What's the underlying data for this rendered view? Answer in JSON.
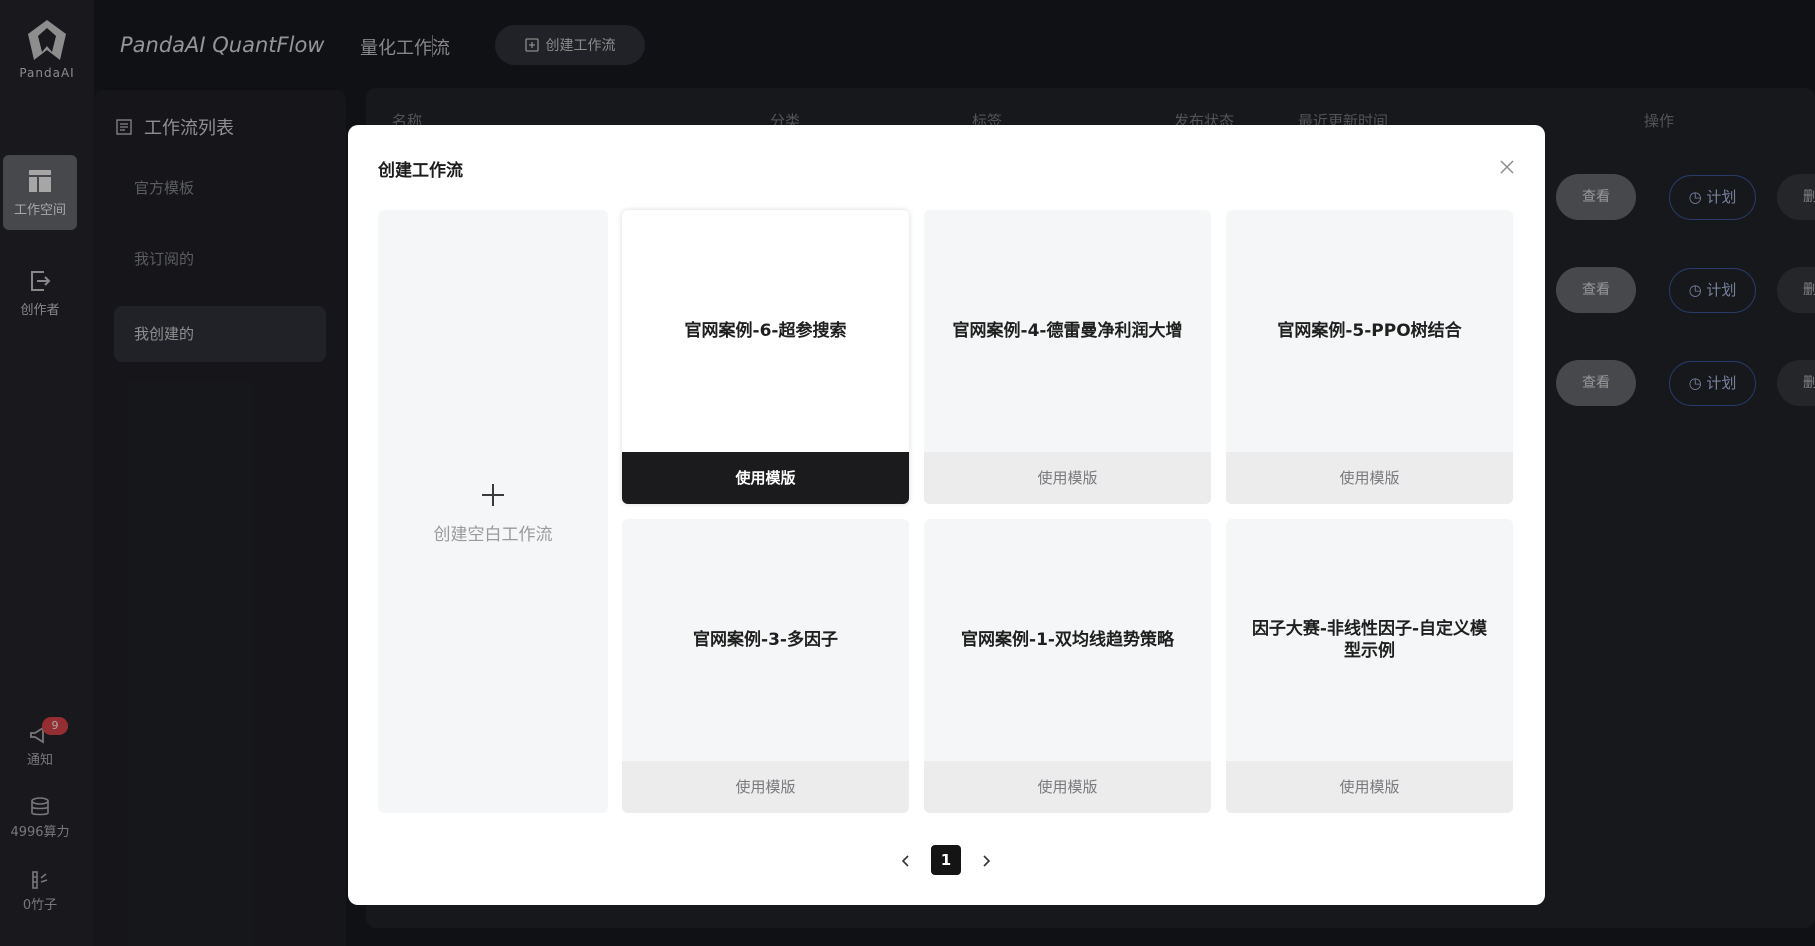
{
  "brand": {
    "name": "PandaAI"
  },
  "rail": {
    "items": [
      {
        "label": "工作空间",
        "icon": "workspace-icon"
      },
      {
        "label": "创作者",
        "icon": "creator-icon"
      }
    ],
    "notify": {
      "label": "通知",
      "badge": "9",
      "icon": "megaphone-icon"
    },
    "compute": {
      "label": "4996算力",
      "icon": "database-icon"
    },
    "bamboo": {
      "label": "0竹子",
      "icon": "bamboo-icon"
    }
  },
  "header": {
    "title": "PandaAI QuantFlow",
    "subtitle": "量化工作流",
    "create_button": "创建工作流"
  },
  "sidepanel": {
    "title": "工作流列表",
    "items": [
      {
        "label": "官方模板"
      },
      {
        "label": "我订阅的"
      },
      {
        "label": "我创建的"
      }
    ]
  },
  "table": {
    "columns": [
      "名称",
      "分类",
      "标签",
      "发布状态",
      "最近更新时间",
      "操作"
    ],
    "actions": {
      "view": "查看",
      "plan": "计划",
      "delete": "删除"
    }
  },
  "modal": {
    "title": "创建工作流",
    "blank_label": "创建空白工作流",
    "templates": [
      {
        "name": "官网案例-6-超参搜索",
        "button": "使用模版"
      },
      {
        "name": "官网案例-4-德雷曼净利润大增",
        "button": "使用模版"
      },
      {
        "name": "官网案例-5-PPO树结合",
        "button": "使用模版"
      },
      {
        "name": "官网案例-3-多因子",
        "button": "使用模版"
      },
      {
        "name": "官网案例-1-双均线趋势策略",
        "button": "使用模版"
      },
      {
        "name": "因子大赛-非线性因子-自定义模型示例",
        "button": "使用模版"
      }
    ],
    "pagination": {
      "current": "1"
    }
  },
  "colors": {
    "accent": "#1b1b1d",
    "badge": "#e5484d",
    "plan_border": "#3f5aa8"
  }
}
